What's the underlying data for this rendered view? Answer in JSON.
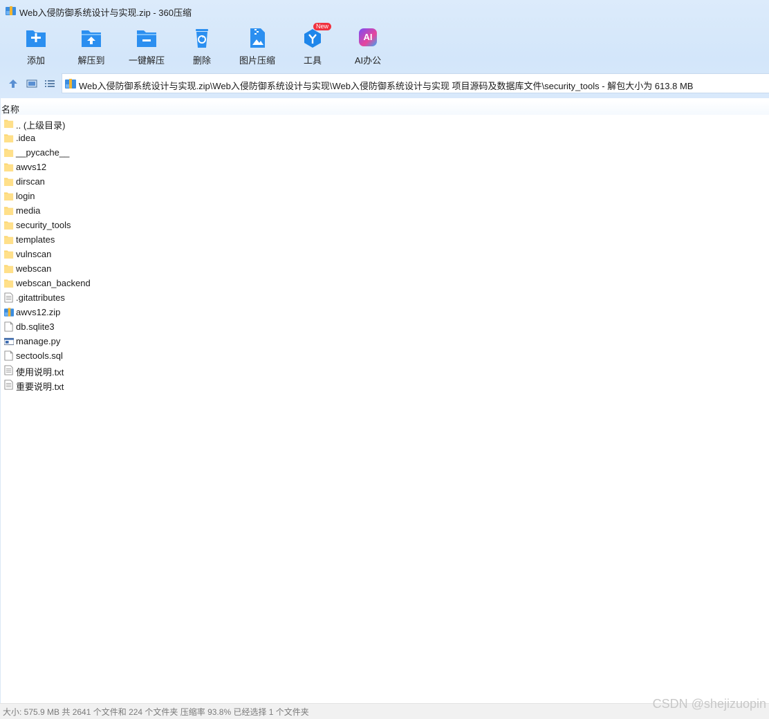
{
  "window": {
    "title": "Web入侵防御系统设计与实现.zip - 360压缩"
  },
  "toolbar": {
    "items": [
      {
        "label": "添加",
        "icon": "add-icon"
      },
      {
        "label": "解压到",
        "icon": "extract-to-icon"
      },
      {
        "label": "一键解压",
        "icon": "one-click-extract-icon"
      },
      {
        "label": "删除",
        "icon": "delete-icon"
      },
      {
        "label": "图片压缩",
        "icon": "image-compress-icon"
      },
      {
        "label": "工具",
        "icon": "tools-icon",
        "badge": "New"
      },
      {
        "label": "AI办公",
        "icon": "ai-office-icon",
        "glyph": "AI"
      }
    ]
  },
  "address": {
    "path": "Web入侵防御系统设计与实现.zip\\Web入侵防御系统设计与实现\\Web入侵防御系统设计与实现 项目源码及数据库文件\\security_tools - 解包大小为 613.8 MB"
  },
  "columns": {
    "name": "名称"
  },
  "files": [
    {
      "name": ".. (上级目录)",
      "type": "folder"
    },
    {
      "name": ".idea",
      "type": "folder"
    },
    {
      "name": "__pycache__",
      "type": "folder"
    },
    {
      "name": "awvs12",
      "type": "folder"
    },
    {
      "name": "dirscan",
      "type": "folder"
    },
    {
      "name": "login",
      "type": "folder"
    },
    {
      "name": "media",
      "type": "folder"
    },
    {
      "name": "security_tools",
      "type": "folder"
    },
    {
      "name": "templates",
      "type": "folder"
    },
    {
      "name": "vulnscan",
      "type": "folder"
    },
    {
      "name": "webscan",
      "type": "folder"
    },
    {
      "name": "webscan_backend",
      "type": "folder"
    },
    {
      "name": ".gitattributes",
      "type": "text"
    },
    {
      "name": "awvs12.zip",
      "type": "zip"
    },
    {
      "name": "db.sqlite3",
      "type": "blank"
    },
    {
      "name": "manage.py",
      "type": "py"
    },
    {
      "name": "sectools.sql",
      "type": "blank"
    },
    {
      "name": "使用说明.txt",
      "type": "text"
    },
    {
      "name": "重要说明.txt",
      "type": "text"
    }
  ],
  "status": {
    "text": "大小: 575.9 MB 共 2641 个文件和 224 个文件夹 压缩率 93.8% 已经选择 1 个文件夹"
  },
  "watermark": "CSDN @shejizuopin",
  "colors": {
    "toolbar_blue": "#2b8ff0",
    "folder_yellow": "#fcd672",
    "badge_red": "#f0313e"
  }
}
